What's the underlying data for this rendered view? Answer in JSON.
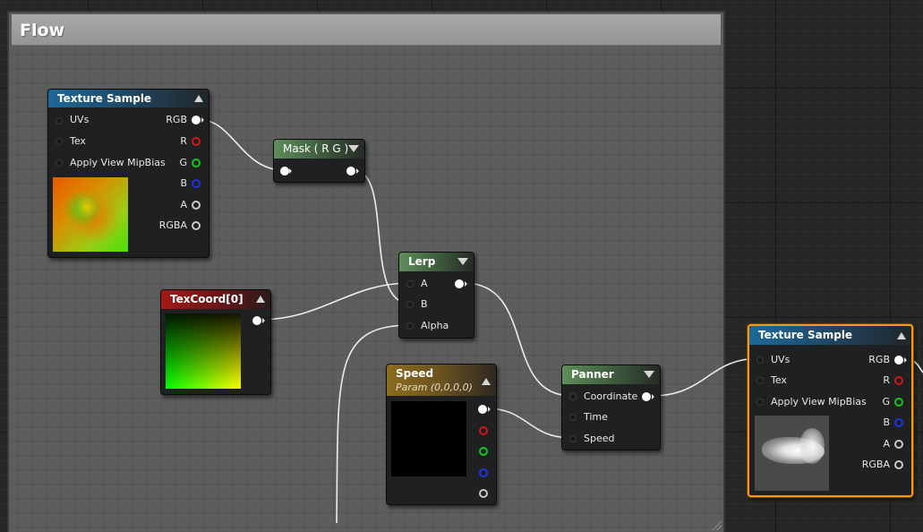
{
  "comment": {
    "title": "Flow"
  },
  "nodes": {
    "texture_sample_1": {
      "title": "Texture Sample",
      "inputs": [
        "UVs",
        "Tex",
        "Apply View MipBias"
      ],
      "outputs": [
        "RGB",
        "R",
        "G",
        "B",
        "A",
        "RGBA"
      ]
    },
    "mask": {
      "title": "Mask ( R G )"
    },
    "lerp": {
      "title": "Lerp",
      "inputs": [
        "A",
        "B",
        "Alpha"
      ]
    },
    "texcoord": {
      "title": "TexCoord[0]"
    },
    "speed": {
      "title": "Speed",
      "subtitle": "Param (0,0,0,0)"
    },
    "panner": {
      "title": "Panner",
      "inputs": [
        "Coordinate",
        "Time",
        "Speed"
      ]
    },
    "texture_sample_2": {
      "title": "Texture Sample",
      "inputs": [
        "UVs",
        "Tex",
        "Apply View MipBias"
      ],
      "outputs": [
        "RGB",
        "R",
        "G",
        "B",
        "A",
        "RGBA"
      ]
    }
  },
  "colors": {
    "selection": "#f59a10",
    "pin_red": "#d41414",
    "pin_green": "#14c814",
    "pin_blue": "#2233dd",
    "texture_header": "#1d6a9a",
    "mask_header": "#5f8e5c",
    "texcoord_header": "#a21919",
    "param_header": "#8b6c1e"
  }
}
